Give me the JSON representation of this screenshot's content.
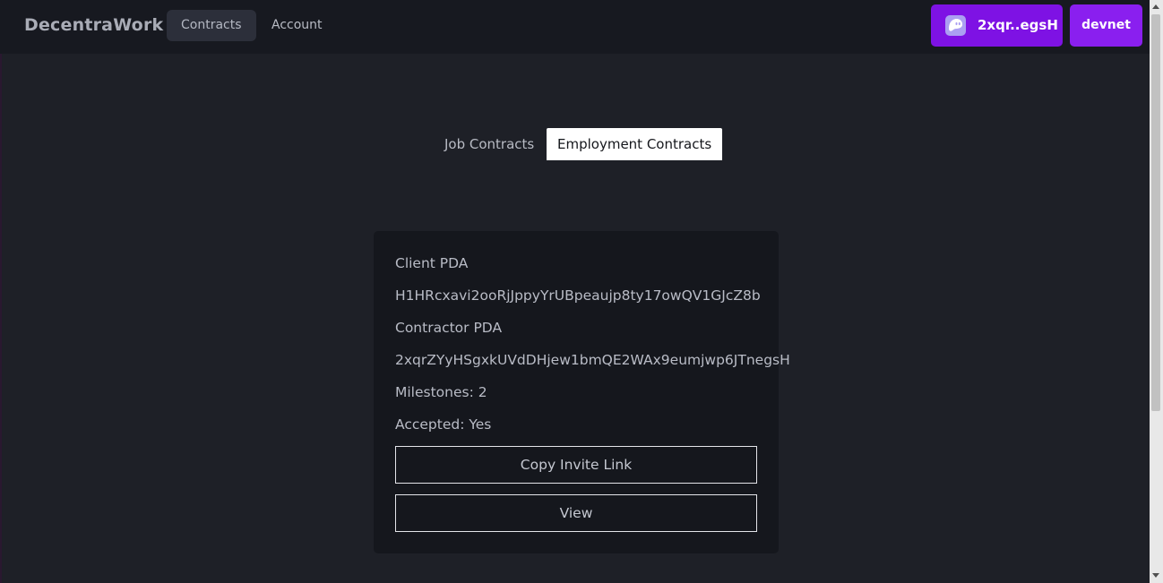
{
  "navbar": {
    "brand": "DecentraWork",
    "links": [
      {
        "label": "Contracts",
        "active": true
      },
      {
        "label": "Account",
        "active": false
      }
    ],
    "wallet": {
      "label": "2xqr..egsH",
      "icon": "phantom-ghost-icon"
    },
    "network": {
      "label": "devnet"
    }
  },
  "tabs": [
    {
      "label": "Job Contracts",
      "active": false
    },
    {
      "label": "Employment Contracts",
      "active": true
    }
  ],
  "card": {
    "client_label": "Client PDA",
    "client_value": "H1HRcxavi2ooRjJppyYrUBpeaujp8ty17owQV1GJcZ8b",
    "contractor_label": "Contractor PDA",
    "contractor_value": "2xqrZYyHSgxkUVdDHjew1bmQE2WAx9eumjwp6JTnegsH",
    "milestones": "Milestones: 2",
    "accepted": "Accepted: Yes",
    "copy_button": "Copy Invite Link",
    "view_button": "View"
  },
  "colors": {
    "wallet_button": "#7e12e4",
    "network_button": "#8a1fef",
    "background": "#1e2027",
    "card": "#15171d"
  }
}
